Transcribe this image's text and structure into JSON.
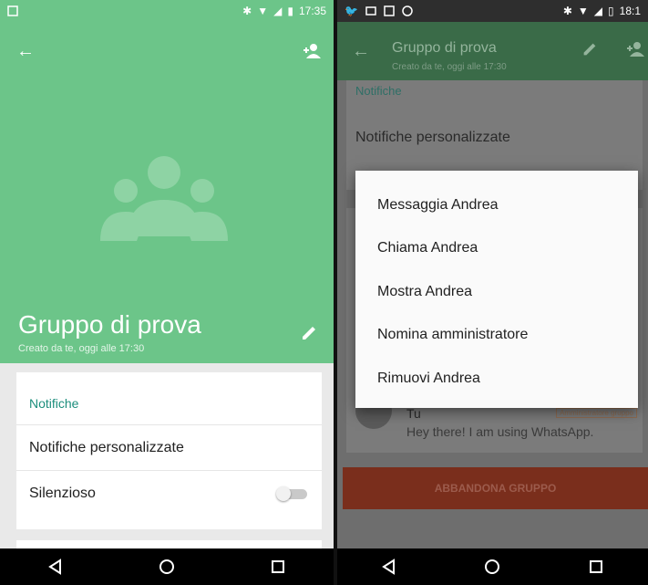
{
  "left": {
    "status": {
      "time": "17:35"
    },
    "group_title": "Gruppo di prova",
    "group_subtitle": "Creato da te, oggi alle 17:30",
    "settings": {
      "section_title": "Notifiche",
      "custom_notifications": "Notifiche personalizzate",
      "mute": "Silenzioso",
      "mute_on": false
    }
  },
  "right": {
    "status": {
      "time": "18:1"
    },
    "appbar": {
      "title": "Gruppo di prova",
      "subtitle": "Creato da te, oggi alle 17:30"
    },
    "section_title": "Notifiche",
    "custom_notifications": "Notifiche personalizzate",
    "menu": [
      "Messaggia Andrea",
      "Chiama Andrea",
      "Mostra Andrea",
      "Nomina amministratore",
      "Rimuovi Andrea"
    ],
    "member": {
      "name": "Tu",
      "badge": "Amministratore gruppo",
      "status": "Hey there! I am using WhatsApp."
    },
    "leave_button": "ABBANDONA GRUPPO"
  },
  "colors": {
    "header_green": "#6cc589",
    "accent_teal": "#1c8e7c",
    "leave_red": "#e8432b"
  }
}
